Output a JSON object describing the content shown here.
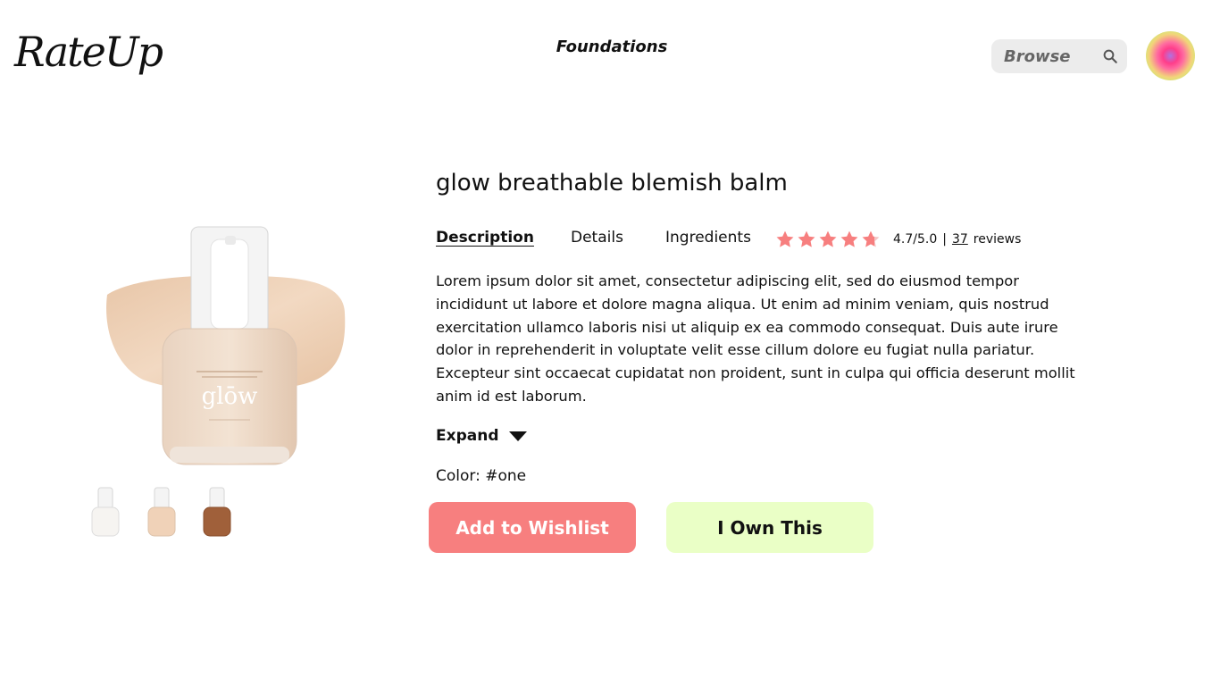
{
  "header": {
    "logo_text": "RateUp",
    "nav_title": "Foundations",
    "search": {
      "placeholder": "Browse",
      "value": ""
    },
    "icons": {
      "search": "search-icon",
      "avatar": "profile-avatar"
    }
  },
  "product": {
    "title": "glow breathable blemish balm",
    "tabs": [
      {
        "label": "Description",
        "active": true
      },
      {
        "label": "Details",
        "active": false
      },
      {
        "label": "Ingredients",
        "active": false
      }
    ],
    "rating": {
      "score_text": "4.7/5.0",
      "separator": "|",
      "review_count": "37",
      "reviews_label": "reviews",
      "stars_filled": 4.7,
      "stars_total": 5
    },
    "description": "Lorem ipsum dolor sit amet, consectetur adipiscing elit, sed do eiusmod tempor incididunt ut labore et dolore magna aliqua. Ut enim ad minim veniam, quis nostrud exercitation ullamco laboris nisi ut aliquip ex ea commodo consequat. Duis aute irure dolor in reprehenderit in voluptate velit esse cillum dolore eu fugiat nulla pariatur. Excepteur sint occaecat cupidatat non proident, sunt in culpa qui officia deserunt mollit anim id est laborum.",
    "expand_label": "Expand",
    "color_line": "Color: #one",
    "image_label": "glōw",
    "thumbnails": [
      "#f6f4f1",
      "#f0d2b8",
      "#a0603a"
    ],
    "buttons": {
      "wishlist": "Add to Wishlist",
      "own": "I Own This"
    }
  },
  "colors": {
    "star": "#f77f7f",
    "wishlist_button": "#f77f7f",
    "own_button": "#eaffc6",
    "search_bg": "#ececec"
  }
}
